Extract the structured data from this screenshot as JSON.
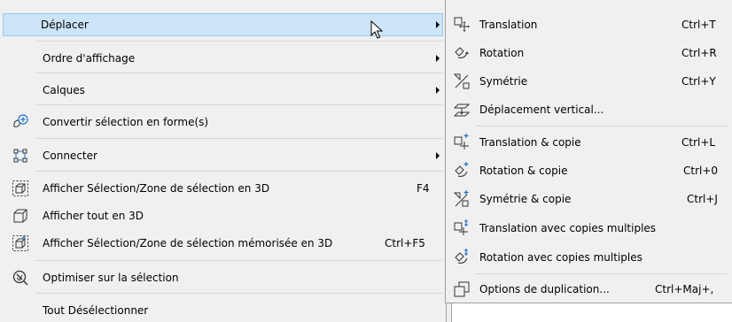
{
  "main_menu": {
    "items": [
      {
        "label": "Déplacer",
        "shortcut": "",
        "submenu": true,
        "icon": ""
      },
      {
        "label": "Ordre d'affichage",
        "shortcut": "",
        "submenu": true,
        "icon": ""
      },
      {
        "label": "Calques",
        "shortcut": "",
        "submenu": true,
        "icon": ""
      },
      {
        "label": "Convertir sélection en forme(s)",
        "shortcut": "",
        "submenu": false,
        "icon": "convert-shape-icon"
      },
      {
        "label": "Connecter",
        "shortcut": "",
        "submenu": true,
        "icon": "connect-icon"
      },
      {
        "label": "Afficher Sélection/Zone de sélection en 3D",
        "shortcut": "F4",
        "submenu": false,
        "icon": "show-selection-3d-icon"
      },
      {
        "label": "Afficher tout en 3D",
        "shortcut": "",
        "submenu": false,
        "icon": "show-all-3d-icon"
      },
      {
        "label": "Afficher Sélection/Zone de sélection mémorisée en 3D",
        "shortcut": "Ctrl+F5",
        "submenu": false,
        "icon": "show-saved-selection-3d-icon"
      },
      {
        "label": "Optimiser sur la sélection",
        "shortcut": "",
        "submenu": false,
        "icon": "optimize-selection-icon"
      },
      {
        "label": "Tout Désélectionner",
        "shortcut": "",
        "submenu": false,
        "icon": ""
      }
    ]
  },
  "sub_menu": {
    "items": [
      {
        "label": "Translation",
        "shortcut": "Ctrl+T",
        "icon": "translation-icon"
      },
      {
        "label": "Rotation",
        "shortcut": "Ctrl+R",
        "icon": "rotation-icon"
      },
      {
        "label": "Symétrie",
        "shortcut": "Ctrl+Y",
        "icon": "symmetry-icon"
      },
      {
        "label": "Déplacement vertical...",
        "shortcut": "",
        "icon": "vertical-move-icon"
      },
      {
        "label": "Translation & copie",
        "shortcut": "Ctrl+L",
        "icon": "translation-copy-icon"
      },
      {
        "label": "Rotation & copie",
        "shortcut": "Ctrl+0",
        "icon": "rotation-copy-icon"
      },
      {
        "label": "Symétrie & copie",
        "shortcut": "Ctrl+J",
        "icon": "symmetry-copy-icon"
      },
      {
        "label": "Translation avec copies multiples",
        "shortcut": "",
        "icon": "translation-multiple-icon"
      },
      {
        "label": "Rotation avec copies multiples",
        "shortcut": "",
        "icon": "rotation-multiple-icon"
      },
      {
        "label": "Options de duplication...",
        "shortcut": "Ctrl+Maj+,",
        "icon": "duplication-options-icon"
      }
    ]
  },
  "colors": {
    "highlight_bg": "#cce4f7",
    "highlight_border": "#99c9ef",
    "menu_bg": "#f0f0f0",
    "icon_blue": "#1e6fc4"
  }
}
